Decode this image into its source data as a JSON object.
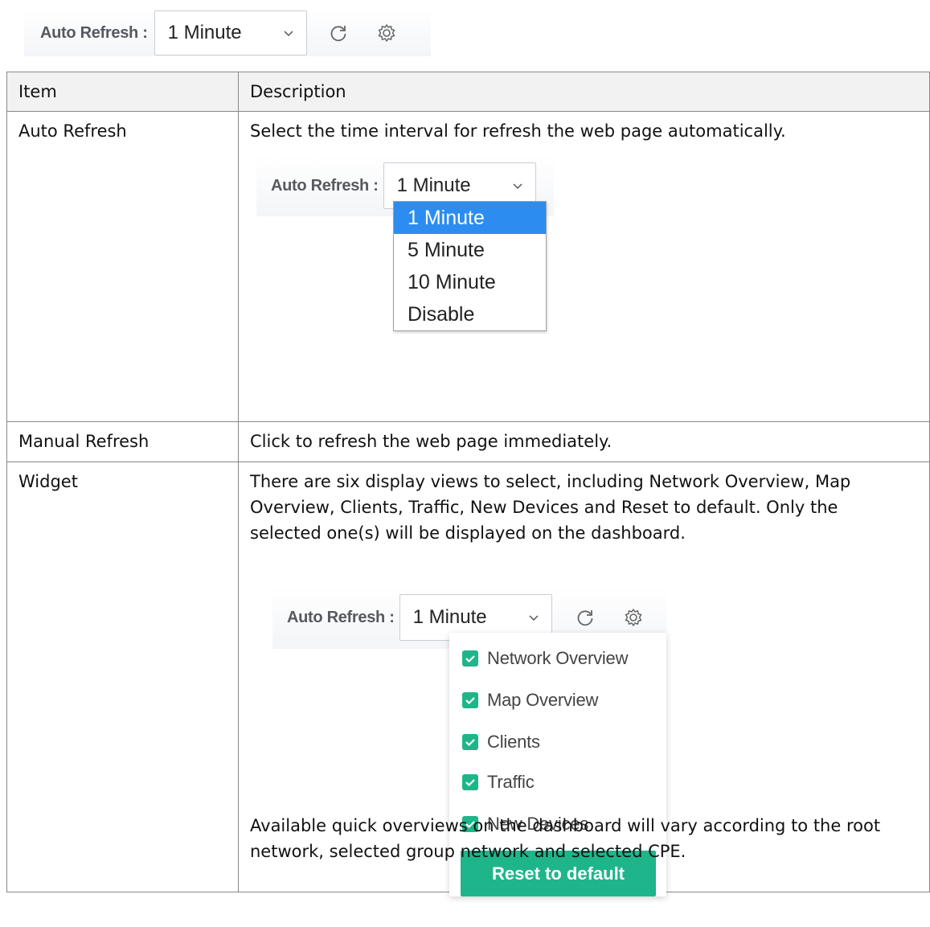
{
  "toolbar": {
    "auto_refresh_label": "Auto Refresh :",
    "interval_value": "1 Minute",
    "chevron_icon": "chevron-down-icon",
    "refresh_icon": "refresh-icon",
    "settings_icon": "gear-icon"
  },
  "table": {
    "headers": {
      "item": "Item",
      "description": "Description"
    },
    "rows": [
      {
        "item": "Auto Refresh",
        "description": "Select the time interval for refresh the web page automatically.",
        "dropdown": {
          "label": "Auto Refresh :",
          "value": "1 Minute",
          "options": [
            "1 Minute",
            "5 Minute",
            "10 Minute",
            "Disable"
          ],
          "selected": "1 Minute"
        }
      },
      {
        "item": "Manual Refresh",
        "description": "Click to refresh the web page immediately."
      },
      {
        "item": "Widget",
        "description": "There are six display views to select, including Network Overview, Map Overview, Clients, Traffic, New Devices and Reset to default. Only the selected one(s) will be displayed on the dashboard.",
        "widget_menu": {
          "label": "Auto Refresh :",
          "value": "1 Minute",
          "items": [
            {
              "label": "Network Overview",
              "checked": true
            },
            {
              "label": "Map Overview",
              "checked": true
            },
            {
              "label": "Clients",
              "checked": true
            },
            {
              "label": "Traffic",
              "checked": true
            },
            {
              "label": "New Devices",
              "checked": true
            }
          ],
          "reset_label": "Reset to default"
        },
        "note": "Available quick overviews on the dashboard will vary according to the root network, selected group network and selected CPE."
      }
    ]
  },
  "colors": {
    "accent_green": "#1fb58a",
    "selected_blue": "#2d8cf0",
    "header_bg": "#f2f2f2"
  }
}
